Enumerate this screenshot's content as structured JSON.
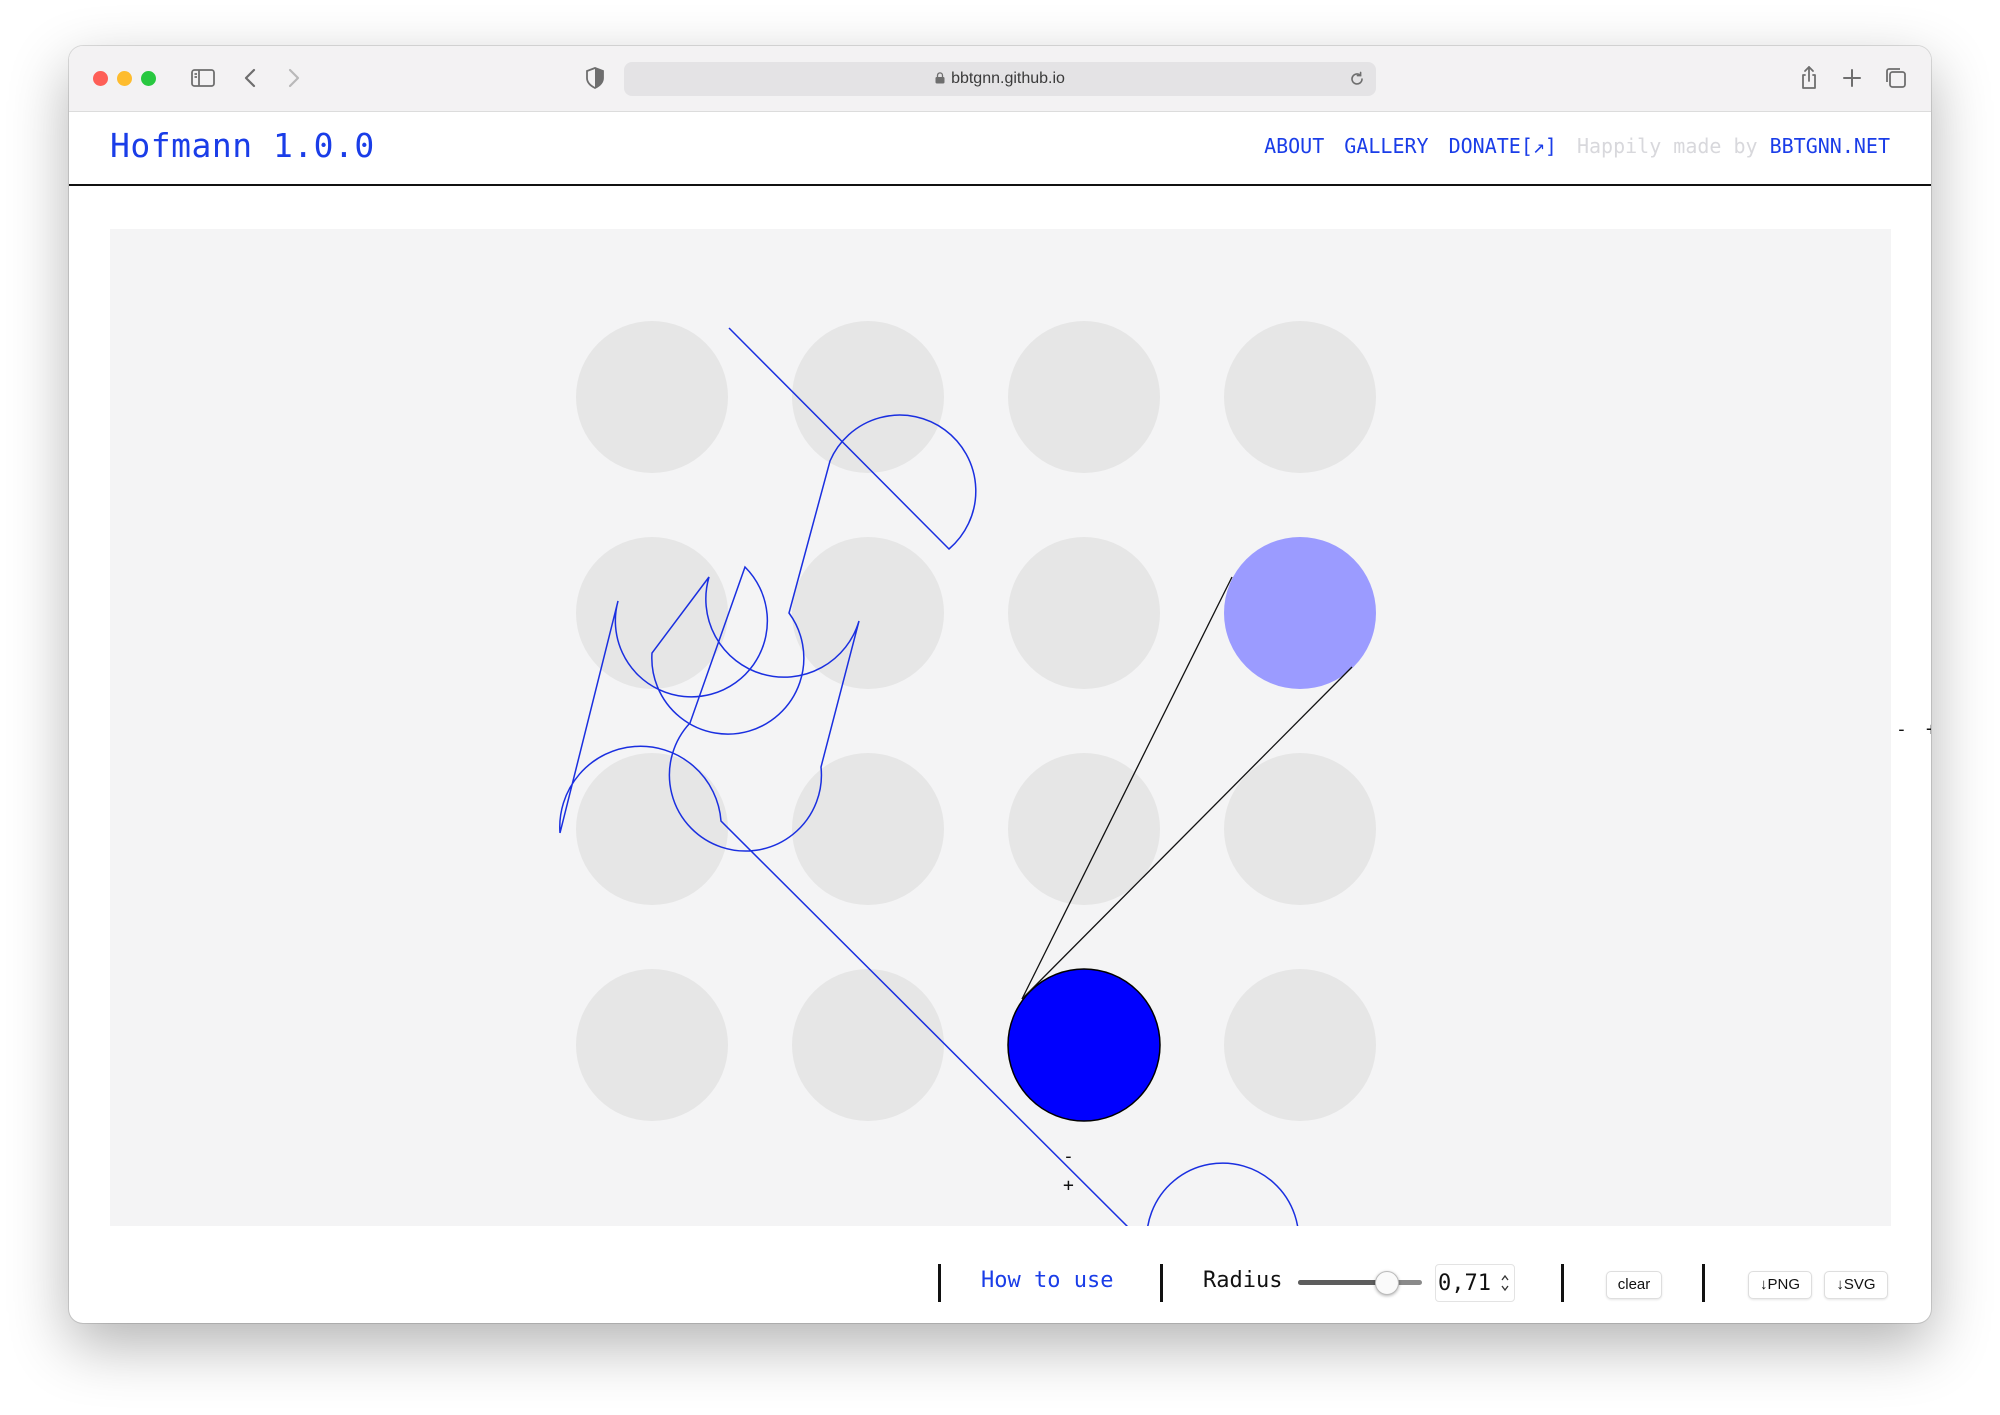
{
  "browser": {
    "url": "bbtgnn.github.io",
    "icons": [
      "sidebar-icon",
      "back-icon",
      "forward-icon",
      "shield-icon",
      "lock-icon",
      "reload-icon",
      "share-icon",
      "new-tab-icon",
      "tabs-overview-icon"
    ]
  },
  "header": {
    "logo": "Hofmann 1.0.0",
    "nav": {
      "about": "ABOUT",
      "gallery": "GALLERY",
      "donate": "DONATE[↗]"
    },
    "credit_text": "Happily made by",
    "credit_link": "BBTGNN.NET"
  },
  "canvas": {
    "grid_cols": 4,
    "grid_rows": 4,
    "highlight_light_cell": [
      3,
      1
    ],
    "highlight_dark_cell": [
      2,
      3
    ],
    "colors": {
      "background": "#f4f4f5",
      "dot": "#e6e6e6",
      "path": "#1a2fe0",
      "active_dot": "#0000ff",
      "selected_dot": "#9b9bff",
      "guide": "#111111"
    },
    "col_controls": {
      "minus": "-",
      "plus": "+"
    },
    "row_controls": {
      "minus": "-",
      "plus": "+"
    }
  },
  "toolbar": {
    "how_to": "How to use",
    "radius_label": "Radius",
    "radius_value": "0,71",
    "radius_fraction": 0.71,
    "clear": "clear",
    "png": "↓PNG",
    "svg": "↓SVG"
  }
}
